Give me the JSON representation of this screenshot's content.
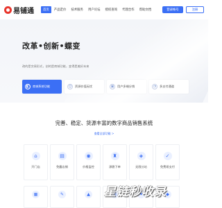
{
  "header": {
    "logo_text": "易铺通",
    "nav": [
      "首页",
      "产品定价",
      "技术服务",
      "用户论坛",
      "授权查询",
      "代理合作",
      "帮助文档"
    ],
    "login_label": "登录帐号",
    "register_label": "注册"
  },
  "hero": {
    "title": "改革•创新•蝶变",
    "subtitle": "改的是交易形式，创的是商城功能，变得是美好未来",
    "features": [
      {
        "label": "商城系统功能",
        "icon": "shop-icon"
      },
      {
        "label": "资源价值无忧",
        "icon": "value-icon"
      },
      {
        "label": "用户多端分销",
        "icon": "users-icon"
      },
      {
        "label": "多支付通道",
        "icon": "payment-icon"
      }
    ]
  },
  "section": {
    "title": "完善、稳定、货源丰富的数字商品销售系统",
    "link": "查看全部功能 >"
  },
  "cards": [
    {
      "label": "开门店",
      "icon": "⌂"
    },
    {
      "label": "免露店铺",
      "icon": "▤"
    },
    {
      "label": "价格监控",
      "icon": "◉"
    },
    {
      "label": "源稳下单",
      "icon": "♜"
    },
    {
      "label": "无限分站",
      "icon": "◈"
    },
    {
      "label": "免费易支付",
      "icon": "✓"
    }
  ],
  "more_cards": [
    {
      "icon": "▦"
    },
    {
      "icon": "✎"
    },
    {
      "icon": "▲"
    },
    {
      "icon": "◎"
    },
    {
      "icon": "✦"
    },
    {
      "icon": "◆"
    }
  ],
  "watermark": "星链秒收录",
  "colors": {
    "accent": "#3b6ff5",
    "logo": "#e8362d"
  }
}
